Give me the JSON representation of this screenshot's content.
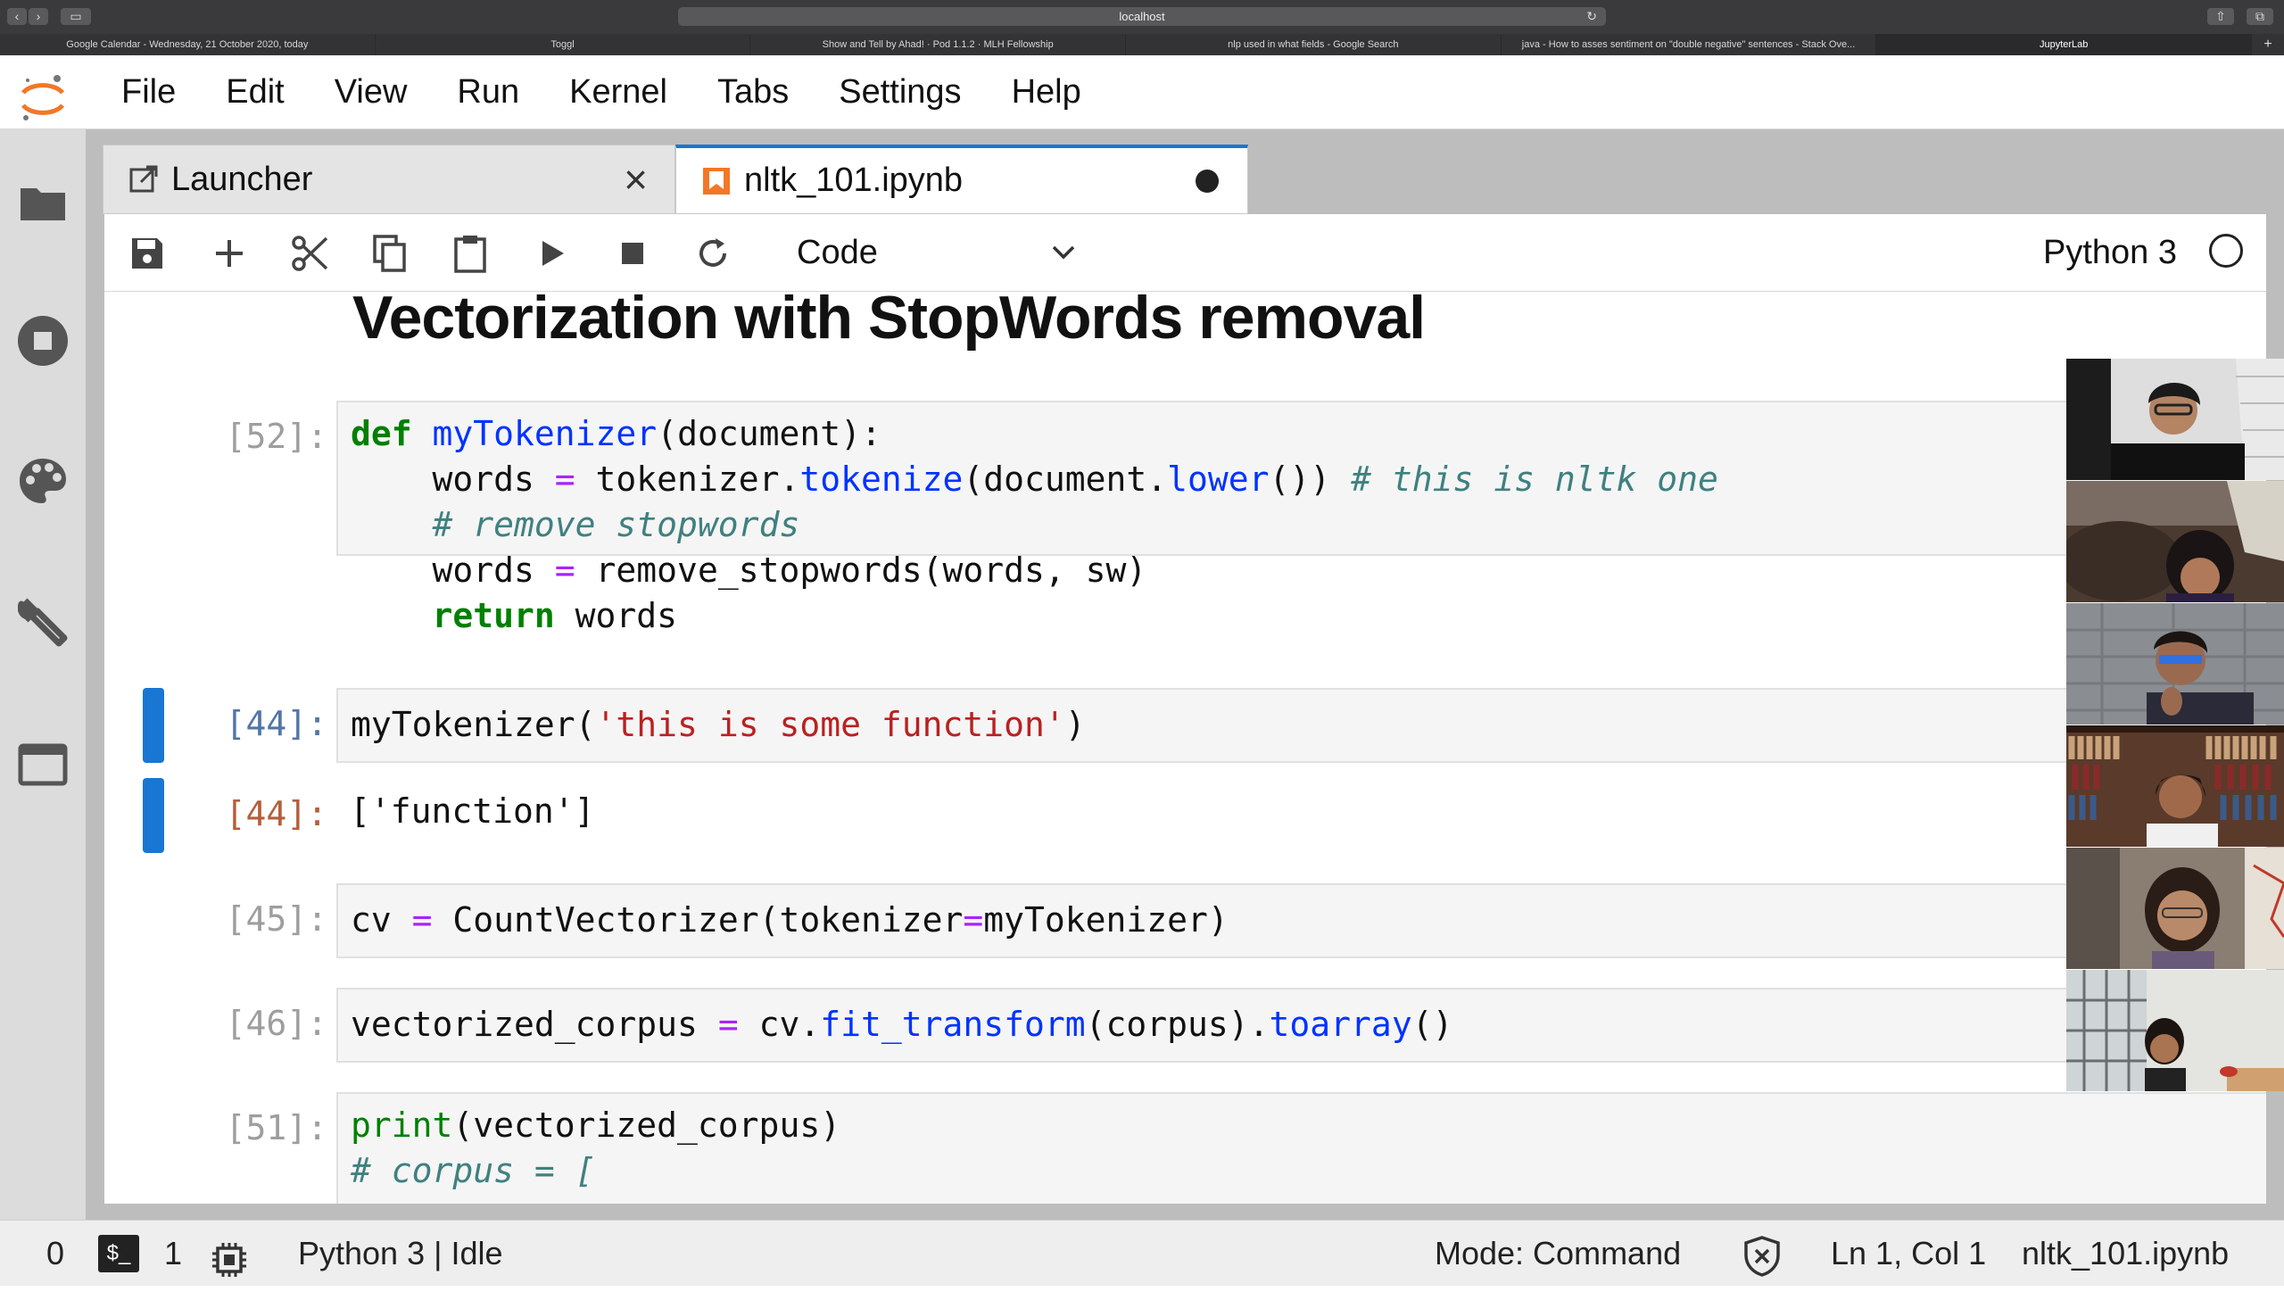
{
  "browser": {
    "url": "localhost",
    "tabs": [
      {
        "title": "Google Calendar - Wednesday, 21 October 2020, today"
      },
      {
        "title": "Toggl"
      },
      {
        "title": "Show and Tell by Ahad! · Pod 1.1.2 · MLH Fellowship"
      },
      {
        "title": "nlp used in what fields - Google Search"
      },
      {
        "title": "java - How to asses sentiment on \"double negative\" sentences - Stack Ove..."
      },
      {
        "title": "JupyterLab"
      }
    ],
    "new_tab_label": "+"
  },
  "menu": {
    "items": [
      "File",
      "Edit",
      "View",
      "Run",
      "Kernel",
      "Tabs",
      "Settings",
      "Help"
    ]
  },
  "sidebar": {
    "icons": [
      "folder-icon",
      "stop-circle-icon",
      "palette-icon",
      "wrench-icon",
      "tabs-icon"
    ]
  },
  "doc_tabs": {
    "launcher": {
      "label": "Launcher",
      "close": "×"
    },
    "notebook": {
      "label": "nltk_101.ipynb"
    }
  },
  "toolbar": {
    "cell_type": "Code",
    "kernel_name": "Python 3"
  },
  "notebook": {
    "heading": "Vectorization with StopWords removal",
    "cells": [
      {
        "prompt": "[52]:"
      },
      {
        "prompt": "[44]:",
        "output_prompt": "[44]:",
        "output": "['function']"
      },
      {
        "prompt": "[45]:"
      },
      {
        "prompt": "[46]:"
      },
      {
        "prompt": "[51]:"
      }
    ]
  },
  "statusbar": {
    "terminals": "0",
    "kernels": "1",
    "kernel_state": "Python 3 | Idle",
    "mode": "Mode: Command",
    "cursor": "Ln 1, Col 1",
    "filename": "nltk_101.ipynb"
  },
  "colors": {
    "accent": "#1976d2",
    "keyword": "#008000",
    "function": "#0033ff",
    "string": "#ba2121",
    "comment": "#408080",
    "operator": "#aa22ff"
  }
}
